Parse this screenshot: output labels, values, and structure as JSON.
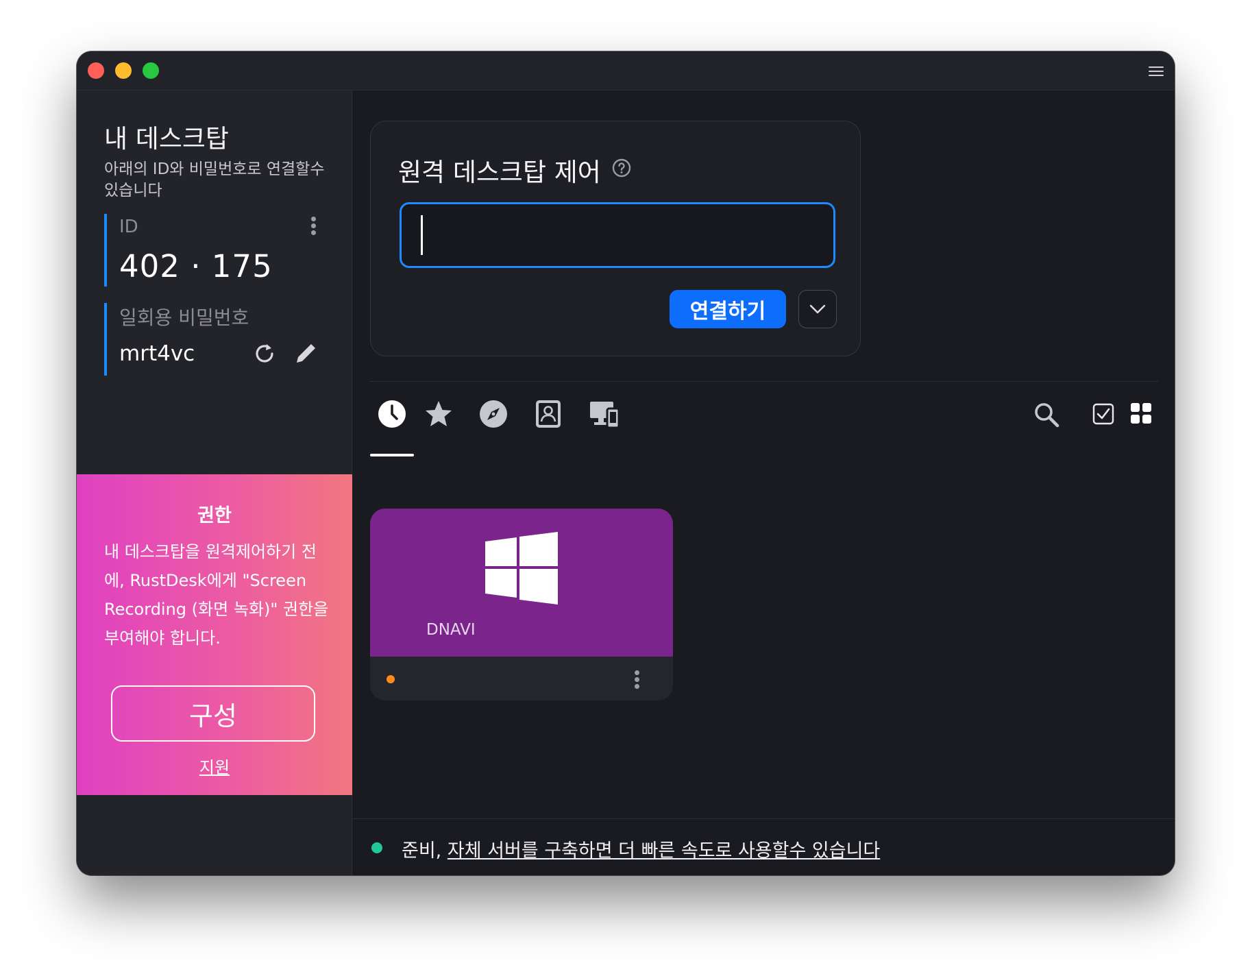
{
  "window": {
    "menu_icon": "hamburger-icon"
  },
  "sidebar": {
    "title": "내 데스크탑",
    "description": "아래의 ID와 비밀번호로 연결할수 있습니다",
    "id_label": "ID",
    "id_value": "402 ·         175",
    "password_label": "일회용 비밀번호",
    "password_value": "mrt4vc",
    "accent_color": "#1e8aff"
  },
  "permission": {
    "title": "권한",
    "text": "내 데스크탑을 원격제어하기 전에, RustDesk에게 \"Screen Recording (화면 녹화)\" 권한을 부여해야 합니다.",
    "button_label": "구성",
    "link_label": "지원"
  },
  "connect": {
    "title": "원격 데스크탑 제어",
    "input_value": "",
    "button_label": "연결하기"
  },
  "tabs": [
    "recent-sessions",
    "favorites",
    "discovered",
    "address-book",
    "accessible-devices"
  ],
  "peer": {
    "name": "DNAVI",
    "os": "windows",
    "status_color": "#ff8c1a",
    "tile_color": "#7a248c"
  },
  "status": {
    "prefix": "준비, ",
    "link": "자체 서버를 구축하면 더 빠른 속도로 사용할수 있습니다",
    "dot_color": "#20c997"
  }
}
